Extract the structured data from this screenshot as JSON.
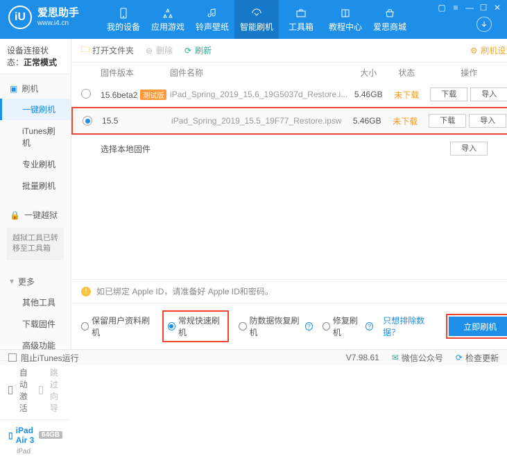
{
  "brand": {
    "title": "爱思助手",
    "url": "www.i4.cn",
    "logo_letter": "iU"
  },
  "win": {
    "menu": "▢",
    "feed": "≡",
    "min": "—",
    "max": "☐",
    "close": "✕"
  },
  "nav": [
    {
      "label": "我的设备"
    },
    {
      "label": "应用游戏"
    },
    {
      "label": "铃声壁纸"
    },
    {
      "label": "智能刷机"
    },
    {
      "label": "工具箱"
    },
    {
      "label": "教程中心"
    },
    {
      "label": "爱思商城"
    }
  ],
  "conn_status": {
    "label": "设备连接状态：",
    "value": "正常模式"
  },
  "sidebar": {
    "flash_head": "刷机",
    "flash_items": [
      "一键刷机",
      "iTunes刷机",
      "专业刷机",
      "批量刷机"
    ],
    "jail_head": "一键越狱",
    "jail_note": "越狱工具已转移至工具箱",
    "more_head": "更多",
    "more_items": [
      "其他工具",
      "下载固件",
      "高级功能"
    ],
    "auto_activate": "自动激活",
    "skip_guide": "跳过向导",
    "device": {
      "name": "iPad Air 3",
      "storage": "64GB",
      "type": "iPad"
    }
  },
  "toolbar": {
    "open": "打开文件夹",
    "delete": "删除",
    "refresh": "刷新",
    "settings": "刷机设置"
  },
  "table": {
    "h_ver": "固件版本",
    "h_name": "固件名称",
    "h_size": "大小",
    "h_status": "状态",
    "h_ops": "操作"
  },
  "fw": [
    {
      "ver": "15.6beta2",
      "badge": "测试版",
      "name": "iPad_Spring_2019_15.6_19G5037d_Restore.i...",
      "size": "5.46GB",
      "status": "未下载",
      "dl": "下载",
      "imp": "导入",
      "sel": false
    },
    {
      "ver": "15.5",
      "badge": "",
      "name": "iPad_Spring_2019_15.5_19F77_Restore.ipsw",
      "size": "5.46GB",
      "status": "未下载",
      "dl": "下载",
      "imp": "导入",
      "sel": true
    }
  ],
  "local": {
    "label": "选择本地固件",
    "imp": "导入"
  },
  "notice": "如已绑定 Apple ID，请准备好 Apple ID和密码。",
  "options": {
    "keep": "保留用户资料刷机",
    "normal": "常规快速刷机",
    "anti": "防数据恢复刷机",
    "repair": "修复刷机",
    "exclude": "只想排除数据？",
    "flash": "立即刷机"
  },
  "footer": {
    "block": "阻止iTunes运行",
    "ver": "V7.98.61",
    "wechat": "微信公众号",
    "update": "检查更新"
  }
}
